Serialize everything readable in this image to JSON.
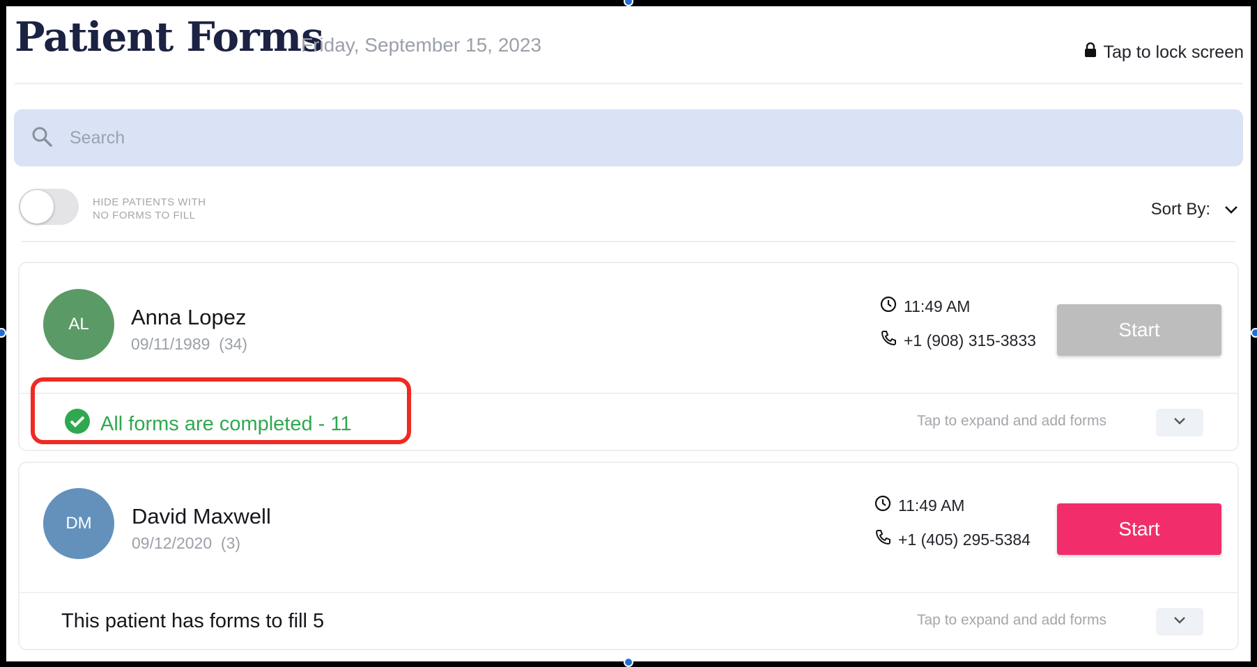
{
  "header": {
    "title": "Patient Forms",
    "date": "Friday, September 15, 2023",
    "lock_label": "Tap to lock screen"
  },
  "search": {
    "placeholder": "Search"
  },
  "filters": {
    "toggle_label_line1": "HIDE PATIENTS WITH",
    "toggle_label_line2": "NO FORMS TO FILL",
    "toggle_on": false,
    "sort_label": "Sort By:"
  },
  "patients": [
    {
      "initials": "AL",
      "avatar_color": "#5a9a66",
      "name": "Anna Lopez",
      "dob": "09/11/1989",
      "age": "(34)",
      "time": "11:49 AM",
      "phone": "+1 (908) 315-3833",
      "start_label": "Start",
      "start_color": "#bdbdbd",
      "status": "All forms are completed - 11",
      "expand_hint": "Tap to expand and add forms"
    },
    {
      "initials": "DM",
      "avatar_color": "#6391bb",
      "name": "David Maxwell",
      "dob": "09/12/2020",
      "age": "(3)",
      "time": "11:49 AM",
      "phone": "+1 (405) 295-5384",
      "start_label": "Start",
      "start_color": "#f12e6b",
      "status": "This patient has forms to fill 5",
      "expand_hint": "Tap to expand and add forms"
    }
  ],
  "colors": {
    "accent_pink": "#f12e6b",
    "success_green": "#2fa84f",
    "highlight_red": "#ef2a22",
    "search_bg": "#d9e3f5"
  }
}
